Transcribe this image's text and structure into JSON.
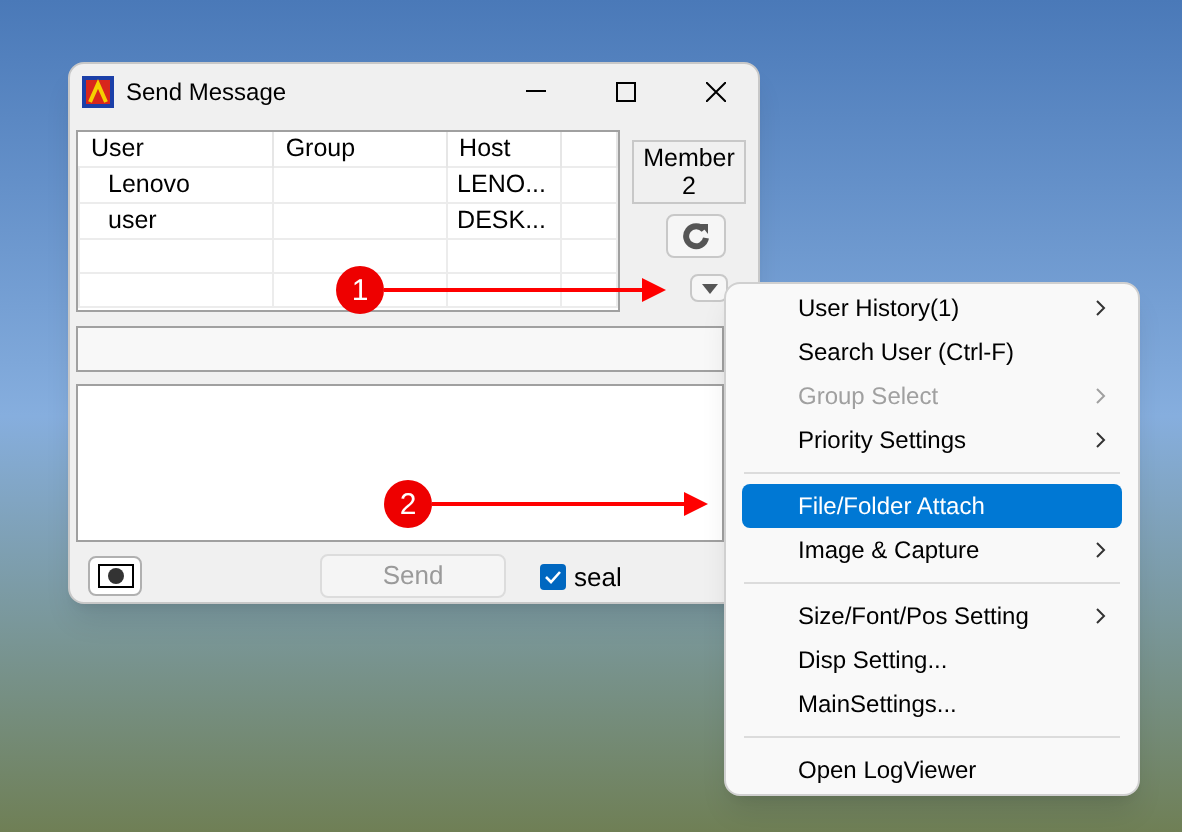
{
  "window": {
    "title": "Send Message"
  },
  "user_list": {
    "columns": [
      "User",
      "Group",
      "Host"
    ],
    "rows": [
      [
        "Lenovo",
        "",
        "LENO..."
      ],
      [
        "user",
        "",
        "DESK..."
      ]
    ]
  },
  "member": {
    "label": "Member",
    "count": "2"
  },
  "bottom_bar": {
    "send_button": {
      "label": "Send",
      "disabled": true
    },
    "seal": {
      "label": "seal",
      "checked": true
    }
  },
  "context_menu": [
    {
      "kind": "item",
      "label": "User History(1)",
      "submenu": true,
      "disabled": false,
      "selected": false
    },
    {
      "kind": "item",
      "label": "Search User (Ctrl-F)",
      "submenu": false,
      "disabled": false,
      "selected": false
    },
    {
      "kind": "item",
      "label": "Group Select",
      "submenu": true,
      "disabled": true,
      "selected": false
    },
    {
      "kind": "item",
      "label": "Priority Settings",
      "submenu": true,
      "disabled": false,
      "selected": false
    },
    {
      "kind": "separator"
    },
    {
      "kind": "item",
      "label": "File/Folder Attach",
      "submenu": false,
      "disabled": false,
      "selected": true
    },
    {
      "kind": "item",
      "label": "Image & Capture",
      "submenu": true,
      "disabled": false,
      "selected": false
    },
    {
      "kind": "separator"
    },
    {
      "kind": "item",
      "label": "Size/Font/Pos Setting",
      "submenu": true,
      "disabled": false,
      "selected": false
    },
    {
      "kind": "item",
      "label": "Disp Setting...",
      "submenu": false,
      "disabled": false,
      "selected": false
    },
    {
      "kind": "item",
      "label": "MainSettings...",
      "submenu": false,
      "disabled": false,
      "selected": false
    },
    {
      "kind": "separator"
    },
    {
      "kind": "item",
      "label": "Open LogViewer",
      "submenu": false,
      "disabled": false,
      "selected": false
    }
  ],
  "callouts": [
    {
      "label": "1"
    },
    {
      "label": "2"
    }
  ]
}
